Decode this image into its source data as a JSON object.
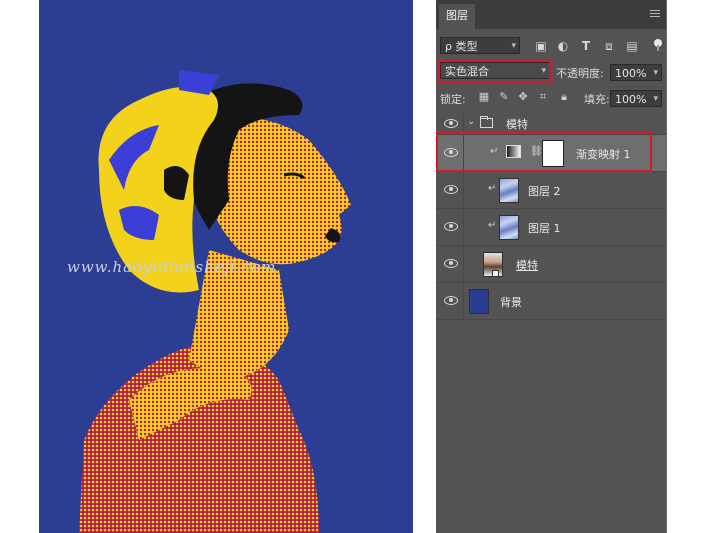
{
  "watermark": "www.haoyidianshejі.com",
  "panel": {
    "tab_label": "图层",
    "filter": {
      "select_label": "ρ 类型",
      "icons": [
        "image-filter-icon",
        "adjustment-filter-icon",
        "type-filter-icon",
        "shape-filter-icon",
        "smart-object-filter-icon"
      ]
    },
    "blend_mode": "实色混合",
    "opacity_label": "不透明度:",
    "opacity_value": "100%",
    "lock_label": "锁定:",
    "lock_icons": [
      "lock-transparent-icon",
      "lock-image-icon",
      "lock-position-icon",
      "lock-artboard-icon",
      "lock-all-icon"
    ],
    "fill_label": "填充:",
    "fill_value": "100%",
    "layers": [
      {
        "name": "模特",
        "type": "group",
        "expanded": true
      },
      {
        "name": "渐变映射 1",
        "type": "gradient-map-adjustment",
        "selected": true,
        "clipped": true
      },
      {
        "name": "图层 2",
        "type": "pixel",
        "clipped": true
      },
      {
        "name": "图层 1",
        "type": "pixel",
        "clipped": true
      },
      {
        "name": "模特",
        "type": "smart-object"
      },
      {
        "name": "背景",
        "type": "background"
      }
    ]
  },
  "colors": {
    "art_background": "#2c3e94",
    "highlight": "#d11a2a",
    "art_yellow": "#f2d21a",
    "art_magenta": "#b0184e"
  }
}
